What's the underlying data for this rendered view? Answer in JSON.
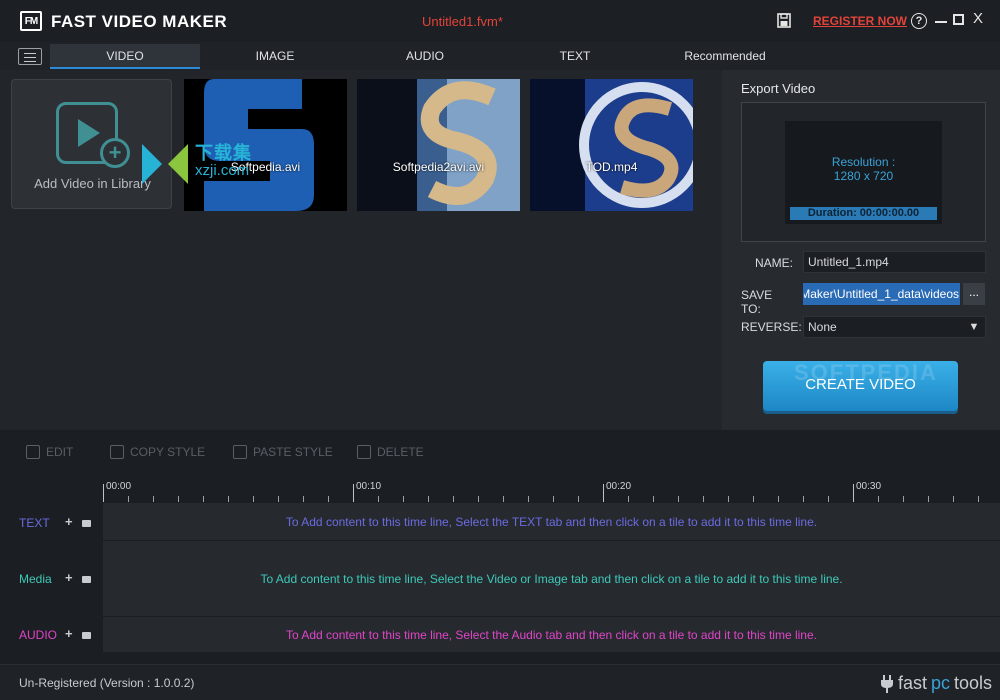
{
  "titlebar": {
    "logo_text": "FM",
    "app_title": "FAST VIDEO MAKER",
    "document_title": "Untitled1.fvm*",
    "register_label": "REGISTER NOW",
    "help_glyph": "?",
    "close_glyph": "X"
  },
  "tabs": [
    {
      "label": "VIDEO",
      "active": true
    },
    {
      "label": "IMAGE",
      "active": false
    },
    {
      "label": "AUDIO",
      "active": false
    },
    {
      "label": "TEXT",
      "active": false
    },
    {
      "label": "Recommended",
      "active": false
    }
  ],
  "library": {
    "add_label": "Add Video in Library",
    "videos": [
      {
        "name": "Softpedia.avi"
      },
      {
        "name": "Softpedia2avi.avi"
      },
      {
        "name": "TOD.mp4"
      }
    ],
    "watermark": {
      "line1": "下载集",
      "line2": "xzji.com"
    }
  },
  "export": {
    "title": "Export Video",
    "resolution_label": "Resolution :",
    "resolution_value": "1280 x 720",
    "duration": "Duration: 00:00:00.00",
    "name_label": "NAME:",
    "name_value": "Untitled_1.mp4",
    "save_label": "SAVE TO:",
    "save_value": "Maker\\Untitled_1_data\\videos",
    "browse_label": "...",
    "reverse_label": "REVERSE:",
    "reverse_value": "None",
    "create_label": "CREATE VIDEO",
    "watermark": "SOFTPEDIA"
  },
  "edit_toolbar": {
    "edit": "EDIT",
    "copy_style": "COPY STYLE",
    "paste_style": "PASTE STYLE",
    "delete": "DELETE"
  },
  "timeline": {
    "ruler_labels": [
      "00:00",
      "00:10",
      "00:20",
      "00:30"
    ],
    "tracks": [
      {
        "label": "TEXT",
        "color": "#6b6be0",
        "hint": "To Add content to this time line, Select the TEXT tab and then click on a tile to add it to this time line."
      },
      {
        "label": "Media",
        "color": "#3ec9b9",
        "hint": "To Add content to this time line, Select the Video or Image tab and then click on a tile to add it to this time line."
      },
      {
        "label": "AUDIO",
        "color": "#e045c8",
        "hint": "To Add content to this time line, Select the Audio tab and then click on a tile to add it to this time line."
      }
    ]
  },
  "status": {
    "text": "Un-Registered (Version : 1.0.0.2)",
    "brand_part1": "fast",
    "brand_part2": "pc",
    "brand_part3": "tools"
  },
  "colors": {
    "accent": "#2d8ad6",
    "alert": "#e2443a"
  }
}
